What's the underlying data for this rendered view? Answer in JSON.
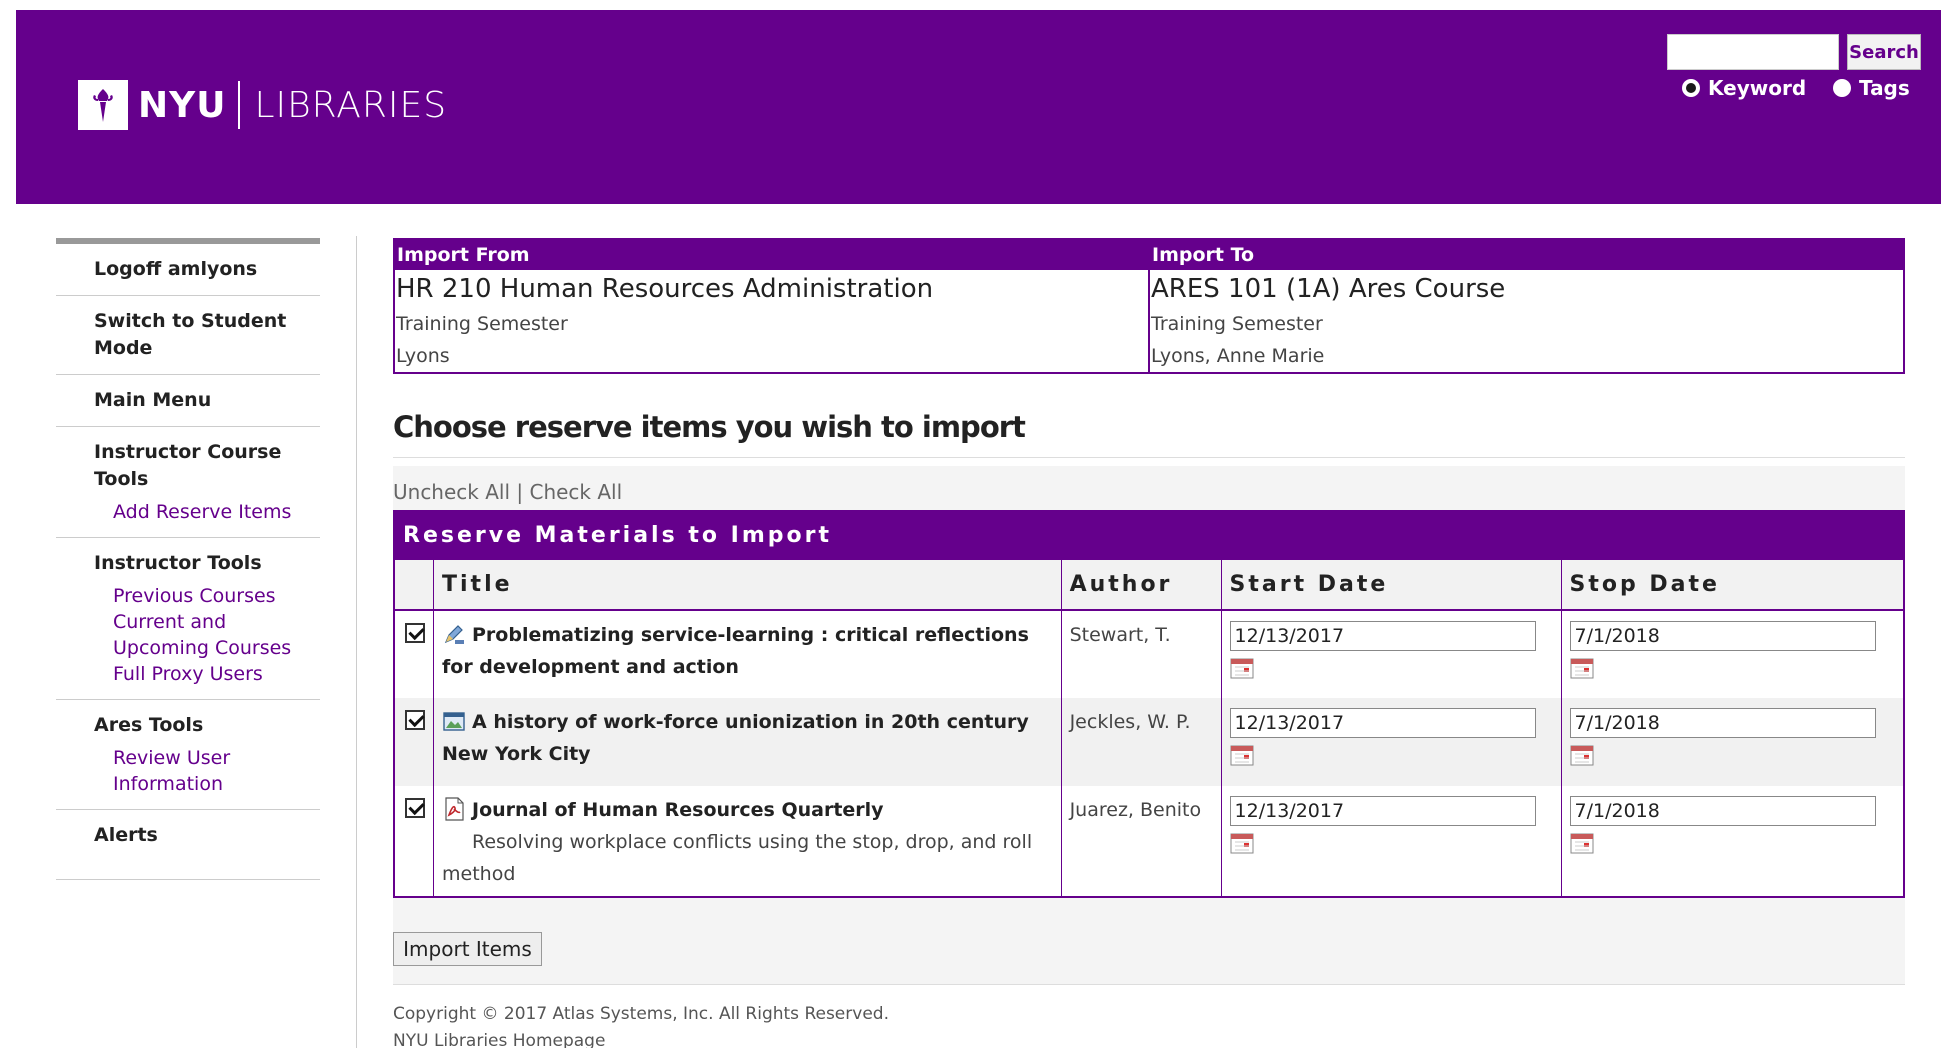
{
  "header": {
    "logo_nyu": "NYU",
    "logo_libraries": "LIBRARIES",
    "search_placeholder": "",
    "search_button": "Search",
    "radio_keyword": "Keyword",
    "radio_tags": "Tags",
    "brand_color": "#65008c"
  },
  "sidebar": {
    "logoff": "Logoff amlyons",
    "switch_student": "Switch to Student Mode",
    "main_menu": "Main Menu",
    "instructor_course_tools": "Instructor Course Tools",
    "add_reserve_items": "Add Reserve Items",
    "instructor_tools": "Instructor Tools",
    "previous_courses": "Previous Courses",
    "current_upcoming": "Current and Upcoming Courses",
    "full_proxy_users": "Full Proxy Users",
    "ares_tools": "Ares Tools",
    "review_user_info": "Review User Information",
    "alerts": "Alerts"
  },
  "import_from": {
    "header": "Import From",
    "course": "HR 210 Human Resources Administration",
    "semester": "Training Semester",
    "instructor": "Lyons"
  },
  "import_to": {
    "header": "Import To",
    "course": "ARES 101 (1A) Ares Course",
    "semester": "Training Semester",
    "instructor": "Lyons, Anne Marie"
  },
  "main": {
    "heading": "Choose reserve items you wish to import",
    "uncheck_all": "Uncheck All",
    "separator": " | ",
    "check_all": "Check All",
    "table_caption": "Reserve Materials to Import",
    "columns": {
      "title": "Title",
      "author": "Author",
      "start_date": "Start Date",
      "stop_date": "Stop Date"
    },
    "items": [
      {
        "icon": "pen-icon",
        "title": "Problematizing service-learning : critical reflections for development and action",
        "subtitle": "",
        "author": "Stewart, T.",
        "start_date": "12/13/2017",
        "stop_date": "7/1/2018",
        "checked": true
      },
      {
        "icon": "image-icon",
        "title": "A history of work-force unionization in 20th century New York City",
        "subtitle": "",
        "author": "Jeckles, W. P.",
        "start_date": "12/13/2017",
        "stop_date": "7/1/2018",
        "checked": true
      },
      {
        "icon": "pdf-icon",
        "title": "Journal of Human Resources Quarterly",
        "subtitle": "Resolving workplace conflicts using the stop, drop, and roll method",
        "author": "Juarez, Benito",
        "start_date": "12/13/2017",
        "stop_date": "7/1/2018",
        "checked": true
      }
    ],
    "import_button": "Import Items"
  },
  "footer": {
    "copyright": "Copyright © 2017 Atlas Systems, Inc. All Rights Reserved.",
    "home_link": "NYU Libraries Homepage"
  }
}
